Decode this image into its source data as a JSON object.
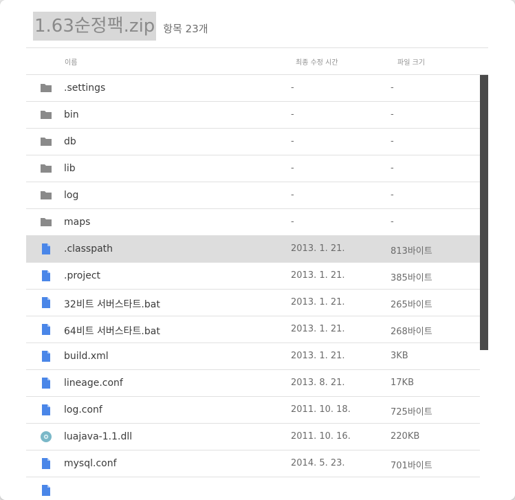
{
  "header": {
    "title": "1.63순정팩.zip",
    "item_count": "항목 23개"
  },
  "columns": {
    "name": "이름",
    "modified": "최종 수정 시간",
    "size": "파일 크기"
  },
  "colors": {
    "folder": "#8a8a8a",
    "file": "#4a86e8",
    "disc": "#7ab8c8",
    "selected_row": "#dddddd",
    "scrollbar": "#4a4a4a"
  },
  "rows": [
    {
      "icon": "folder-icon",
      "name": ".settings",
      "modified": "-",
      "size": "-"
    },
    {
      "icon": "folder-icon",
      "name": "bin",
      "modified": "-",
      "size": "-"
    },
    {
      "icon": "folder-icon",
      "name": "db",
      "modified": "-",
      "size": "-"
    },
    {
      "icon": "folder-icon",
      "name": "lib",
      "modified": "-",
      "size": "-"
    },
    {
      "icon": "folder-icon",
      "name": "log",
      "modified": "-",
      "size": "-"
    },
    {
      "icon": "folder-icon",
      "name": "maps",
      "modified": "-",
      "size": "-"
    },
    {
      "icon": "file-icon",
      "name": ".classpath",
      "modified": "2013. 1. 21.",
      "size": "813바이트",
      "selected": true
    },
    {
      "icon": "file-icon",
      "name": ".project",
      "modified": "2013. 1. 21.",
      "size": "385바이트"
    },
    {
      "icon": "file-icon",
      "name": "32비트 서버스타트.bat",
      "modified": "2013. 1. 21.",
      "size": "265바이트"
    },
    {
      "icon": "file-icon",
      "name": "64비트 서버스타트.bat",
      "modified": "2013. 1. 21.",
      "size": "268바이트"
    },
    {
      "icon": "file-icon",
      "name": "build.xml",
      "modified": "2013. 1. 21.",
      "size": "3KB"
    },
    {
      "icon": "file-icon",
      "name": "lineage.conf",
      "modified": "2013. 8. 21.",
      "size": "17KB"
    },
    {
      "icon": "file-icon",
      "name": "log.conf",
      "modified": "2011. 10. 18.",
      "size": "725바이트"
    },
    {
      "icon": "disc-icon",
      "name": "luajava-1.1.dll",
      "modified": "2011. 10. 16.",
      "size": "220KB"
    },
    {
      "icon": "file-icon",
      "name": "mysql.conf",
      "modified": "2014. 5. 23.",
      "size": "701바이트"
    },
    {
      "icon": "file-icon",
      "name": "",
      "modified": "",
      "size": ""
    }
  ]
}
